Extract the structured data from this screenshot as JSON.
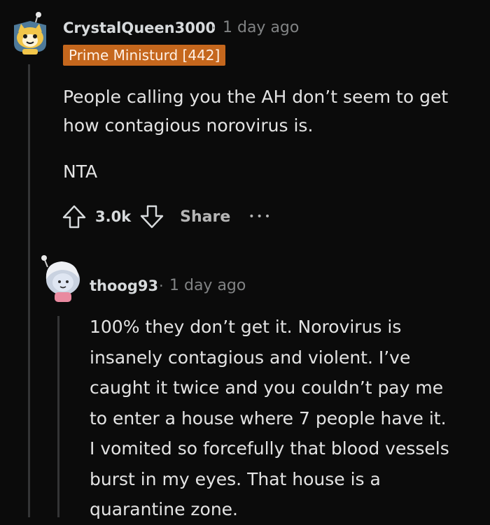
{
  "comments": [
    {
      "username": "CrystalQueen3000",
      "separator": "·",
      "time": "1 day ago",
      "flair": "Prime Ministurd [442]",
      "paragraphs": [
        "People calling you the AH don’t seem to get",
        "how contagious norovirus is.",
        "NTA"
      ],
      "votes": "3.0k",
      "share_label": "Share",
      "more_label": "•••"
    },
    {
      "username": "thoog93",
      "separator": "·",
      "time": "1 day ago",
      "lines": [
        "100% they don’t get it. Norovirus is",
        "insanely contagious and violent. I’ve",
        "caught it twice and you couldn’t pay me",
        "to enter a house where 7 people have it.",
        "I vomited so forcefully that blood vessels",
        "burst in my eyes. That house is a",
        "quarantine zone."
      ]
    }
  ],
  "colors": {
    "background": "#0b0b0b",
    "flair_bg": "#c5671d",
    "thread_line": "#343536"
  },
  "icons": [
    "snoo-avatar-icon",
    "upvote-icon",
    "downvote-icon",
    "more-icon",
    "snoo-avatar-icon"
  ]
}
